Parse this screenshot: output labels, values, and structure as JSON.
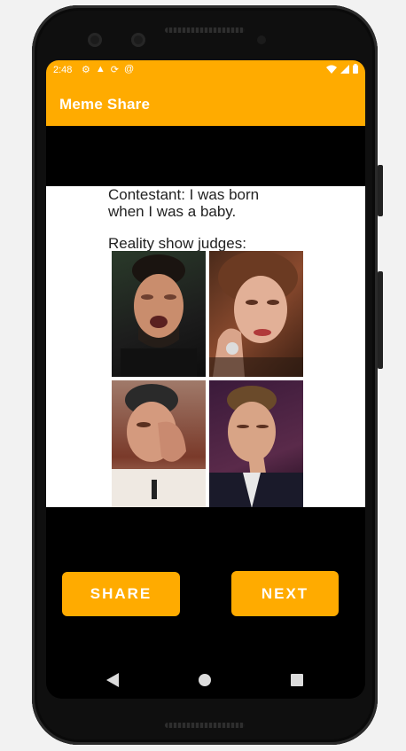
{
  "status_bar": {
    "time": "2:48",
    "left_icons": [
      "gear-icon",
      "warning-icon",
      "sync-icon",
      "at-icon"
    ],
    "right_icons": [
      "wifi-icon",
      "signal-icon",
      "battery-icon"
    ]
  },
  "app_bar": {
    "title": "Meme Share"
  },
  "meme": {
    "caption_line1": "Contestant: I was born",
    "caption_line2": "when I was a baby.",
    "caption_line3": "Reality show judges:",
    "panels": [
      "crying-judge-1",
      "crying-judge-2",
      "crying-judge-3",
      "crying-judge-4"
    ]
  },
  "buttons": {
    "share": "SHARE",
    "next": "NEXT"
  },
  "nav": {
    "back": "back-icon",
    "home": "home-icon",
    "recents": "recents-icon"
  },
  "colors": {
    "accent": "#FFAB00",
    "screen_bg": "#000000"
  }
}
